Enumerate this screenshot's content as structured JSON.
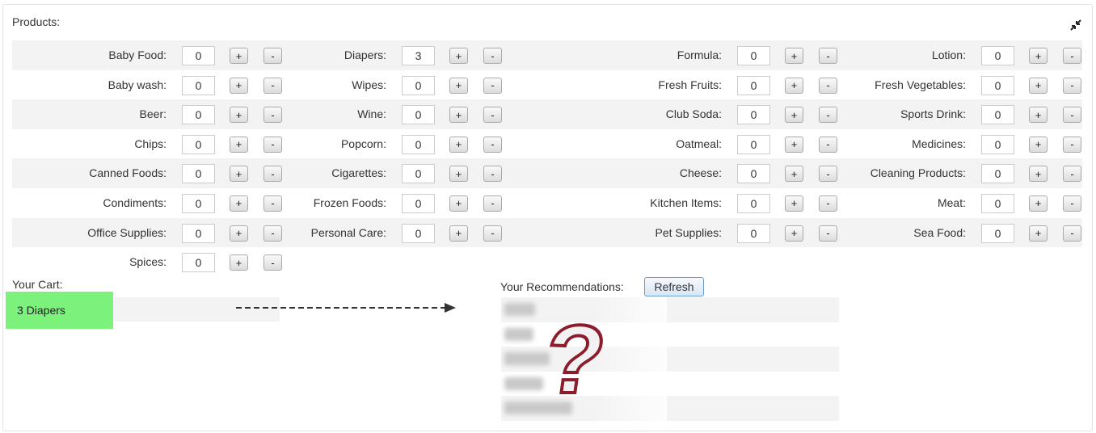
{
  "panel": {
    "title": "Products:"
  },
  "products": {
    "rows": [
      [
        {
          "label": "Baby Food:",
          "qty": "0"
        },
        {
          "label": "Diapers:",
          "qty": "3"
        },
        {
          "label": "Formula:",
          "qty": "0"
        },
        {
          "label": "Lotion:",
          "qty": "0"
        }
      ],
      [
        {
          "label": "Baby wash:",
          "qty": "0"
        },
        {
          "label": "Wipes:",
          "qty": "0"
        },
        {
          "label": "Fresh Fruits:",
          "qty": "0"
        },
        {
          "label": "Fresh Vegetables:",
          "qty": "0"
        }
      ],
      [
        {
          "label": "Beer:",
          "qty": "0"
        },
        {
          "label": "Wine:",
          "qty": "0"
        },
        {
          "label": "Club Soda:",
          "qty": "0"
        },
        {
          "label": "Sports Drink:",
          "qty": "0"
        }
      ],
      [
        {
          "label": "Chips:",
          "qty": "0"
        },
        {
          "label": "Popcorn:",
          "qty": "0"
        },
        {
          "label": "Oatmeal:",
          "qty": "0"
        },
        {
          "label": "Medicines:",
          "qty": "0"
        }
      ],
      [
        {
          "label": "Canned Foods:",
          "qty": "0"
        },
        {
          "label": "Cigarettes:",
          "qty": "0"
        },
        {
          "label": "Cheese:",
          "qty": "0"
        },
        {
          "label": "Cleaning Products:",
          "qty": "0"
        }
      ],
      [
        {
          "label": "Condiments:",
          "qty": "0"
        },
        {
          "label": "Frozen Foods:",
          "qty": "0"
        },
        {
          "label": "Kitchen Items:",
          "qty": "0"
        },
        {
          "label": "Meat:",
          "qty": "0"
        }
      ],
      [
        {
          "label": "Office Supplies:",
          "qty": "0"
        },
        {
          "label": "Personal Care:",
          "qty": "0"
        },
        {
          "label": "Pet Supplies:",
          "qty": "0"
        },
        {
          "label": "Sea Food:",
          "qty": "0"
        }
      ],
      [
        {
          "label": "Spices:",
          "qty": "0"
        }
      ]
    ],
    "plus_label": "+",
    "minus_label": "-"
  },
  "cart": {
    "title": "Your Cart:",
    "items": [
      "3 Diapers"
    ]
  },
  "recommendations": {
    "title": "Your Recommendations:",
    "refresh_label": "Refresh"
  },
  "icons": {
    "collapse": "collapse-arrows-icon",
    "arrow": "dashed-arrow-right-icon",
    "question": "question-mark-icon"
  },
  "colors": {
    "cart_highlight": "#7cf27c",
    "row_shade": "#f3f3f3",
    "question_fill": "#f2f2f2",
    "question_outline": "#8b1d2c"
  }
}
